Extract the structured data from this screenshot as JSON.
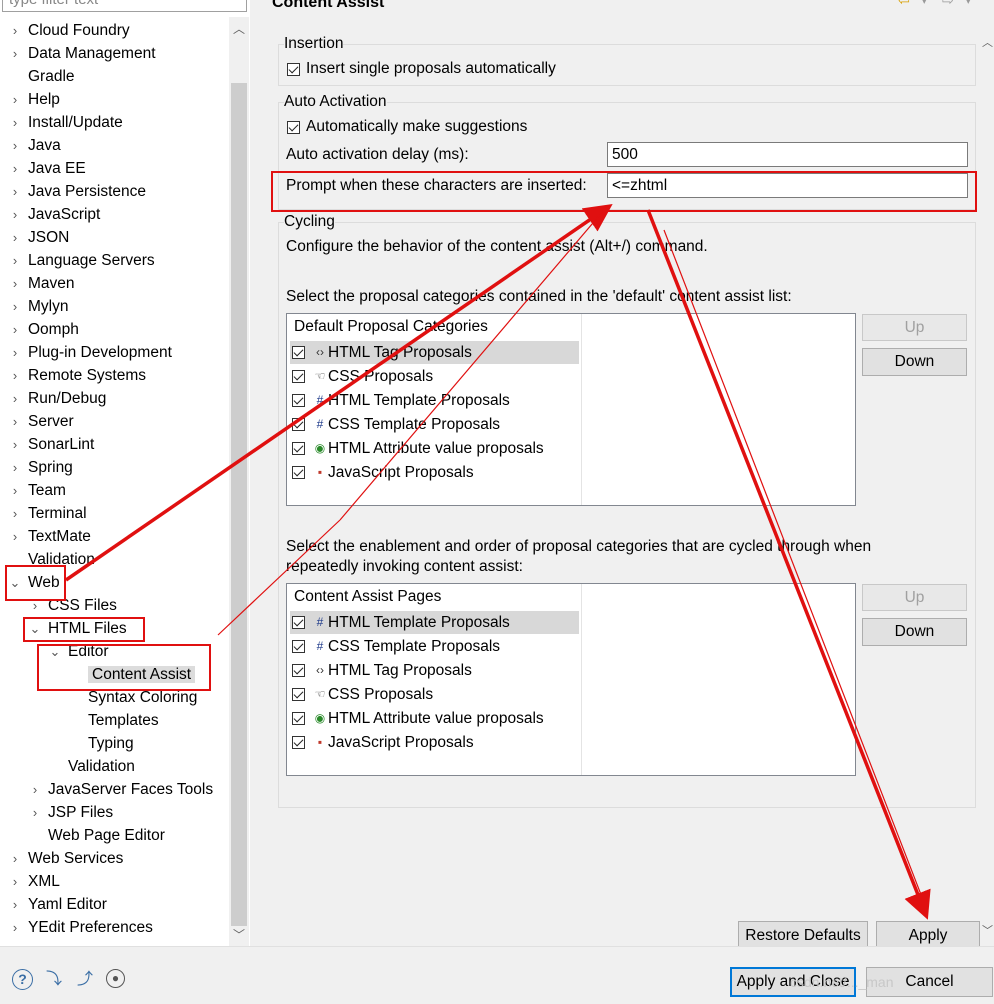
{
  "filter": {
    "placeholder": "type filter text"
  },
  "tree": {
    "items": [
      {
        "label": "Cloud Foundry",
        "twisty": "›"
      },
      {
        "label": "Data Management",
        "twisty": "›"
      },
      {
        "label": "Gradle",
        "twisty": ""
      },
      {
        "label": "Help",
        "twisty": "›"
      },
      {
        "label": "Install/Update",
        "twisty": "›"
      },
      {
        "label": "Java",
        "twisty": "›"
      },
      {
        "label": "Java EE",
        "twisty": "›"
      },
      {
        "label": "Java Persistence",
        "twisty": "›"
      },
      {
        "label": "JavaScript",
        "twisty": "›"
      },
      {
        "label": "JSON",
        "twisty": "›"
      },
      {
        "label": "Language Servers",
        "twisty": "›"
      },
      {
        "label": "Maven",
        "twisty": "›"
      },
      {
        "label": "Mylyn",
        "twisty": "›"
      },
      {
        "label": "Oomph",
        "twisty": "›"
      },
      {
        "label": "Plug-in Development",
        "twisty": "›"
      },
      {
        "label": "Remote Systems",
        "twisty": "›"
      },
      {
        "label": "Run/Debug",
        "twisty": "›"
      },
      {
        "label": "Server",
        "twisty": "›"
      },
      {
        "label": "SonarLint",
        "twisty": "›"
      },
      {
        "label": "Spring",
        "twisty": "›"
      },
      {
        "label": "Team",
        "twisty": "›"
      },
      {
        "label": "Terminal",
        "twisty": "›"
      },
      {
        "label": "TextMate",
        "twisty": "›"
      },
      {
        "label": "Validation",
        "twisty": ""
      },
      {
        "label": "Web",
        "twisty": "⌄"
      },
      {
        "label": "CSS Files",
        "twisty": "›"
      },
      {
        "label": "HTML Files",
        "twisty": "⌄"
      },
      {
        "label": "Editor",
        "twisty": "⌄"
      },
      {
        "label": "Content Assist",
        "twisty": ""
      },
      {
        "label": "Syntax Coloring",
        "twisty": ""
      },
      {
        "label": "Templates",
        "twisty": ""
      },
      {
        "label": "Typing",
        "twisty": ""
      },
      {
        "label": "Validation",
        "twisty": ""
      },
      {
        "label": "JavaServer Faces Tools",
        "twisty": "›"
      },
      {
        "label": "JSP Files",
        "twisty": "›"
      },
      {
        "label": "Web Page Editor",
        "twisty": ""
      },
      {
        "label": "Web Services",
        "twisty": "›"
      },
      {
        "label": "XML",
        "twisty": "›"
      },
      {
        "label": "Yaml Editor",
        "twisty": "›"
      },
      {
        "label": "YEdit Preferences",
        "twisty": "›"
      }
    ],
    "selected_label": "Content Assist"
  },
  "page": {
    "title": "Content Assist"
  },
  "insertion": {
    "title": "Insertion",
    "single_proposals_label": "Insert single proposals automatically"
  },
  "auto_activation": {
    "title": "Auto Activation",
    "suggestions_label": "Automatically make suggestions",
    "delay_label": "Auto activation delay (ms):",
    "delay_value": "500",
    "prompt_label": "Prompt when these characters are inserted:",
    "prompt_value": "<=zhtml"
  },
  "cycling": {
    "title": "Cycling",
    "description": "Configure the behavior of the content assist (Alt+/) command.",
    "default_list_label": "Select the proposal categories contained in the 'default' content assist list:",
    "default_header": "Default Proposal Categories",
    "default_items": [
      {
        "label": "HTML Tag Proposals",
        "icon": "‹›"
      },
      {
        "label": "CSS Proposals",
        "icon": "☜"
      },
      {
        "label": "HTML Template Proposals",
        "icon": "#"
      },
      {
        "label": "CSS Template Proposals",
        "icon": "#"
      },
      {
        "label": "HTML Attribute value proposals",
        "icon": "◉"
      },
      {
        "label": "JavaScript Proposals",
        "icon": "▪"
      }
    ],
    "cycle_list_label_1": "Select the enablement and order of proposal categories that are cycled through when",
    "cycle_list_label_2": "repeatedly invoking content assist:",
    "pages_header": "Content Assist Pages",
    "pages_items": [
      {
        "label": "HTML Template Proposals",
        "icon": "#"
      },
      {
        "label": "CSS Template Proposals",
        "icon": "#"
      },
      {
        "label": "HTML Tag Proposals",
        "icon": "‹›"
      },
      {
        "label": "CSS Proposals",
        "icon": "☜"
      },
      {
        "label": "HTML Attribute value proposals",
        "icon": "◉"
      },
      {
        "label": "JavaScript Proposals",
        "icon": "▪"
      }
    ],
    "up_label": "Up",
    "down_label": "Down"
  },
  "buttons": {
    "restore_defaults": "Restore Defaults",
    "apply": "Apply",
    "apply_and_close": "Apply and Close",
    "cancel": "Cancel"
  },
  "watermark": "csdn.net/..._man",
  "colors": {
    "annotation": "#e01010",
    "selection": "#d8d8d8",
    "focus": "#0078d7"
  }
}
